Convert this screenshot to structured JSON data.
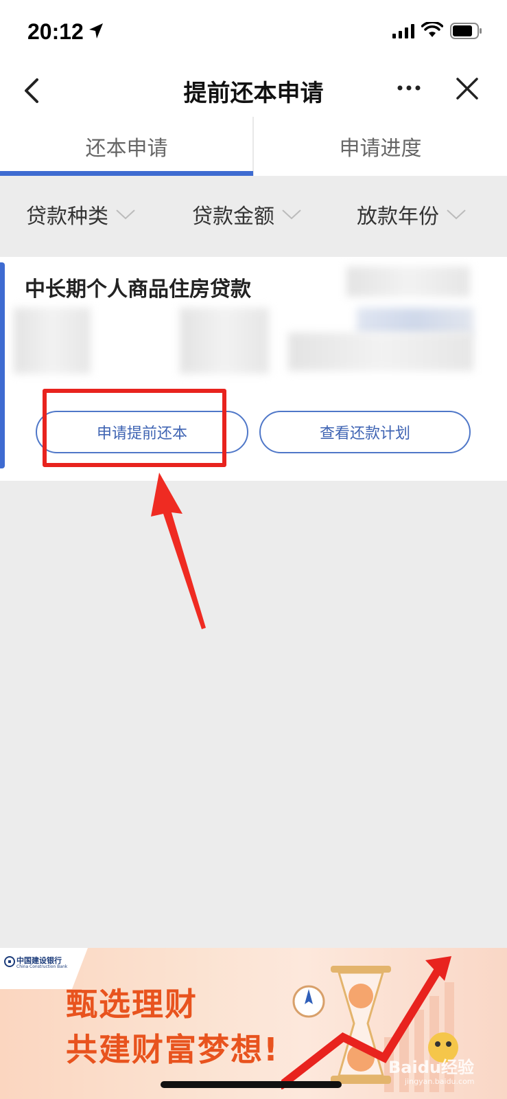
{
  "status_bar": {
    "time": "20:12",
    "icons": [
      "location-arrow-icon",
      "cellular-signal-icon",
      "wifi-icon",
      "battery-icon"
    ]
  },
  "nav": {
    "title": "提前还本申请",
    "back_icon": "chevron-left-icon",
    "more_icon": "more-dots-icon",
    "close_icon": "close-icon"
  },
  "tabs": [
    {
      "label": "还本申请",
      "active": true
    },
    {
      "label": "申请进度",
      "active": false
    }
  ],
  "filters": [
    {
      "label": "贷款种类"
    },
    {
      "label": "贷款金额"
    },
    {
      "label": "放款年份"
    }
  ],
  "loan_card": {
    "title": "中长期个人商品住房贷款",
    "buttons": {
      "apply": "申请提前还本",
      "plan": "查看还款计划"
    }
  },
  "banner": {
    "bank_name": "中国建设银行",
    "bank_name_en": "China Construction Bank",
    "line1": "甄选理财",
    "line2": "共建财富梦想!",
    "watermark": "Baidu经验",
    "watermark_sub": "jingyan.baidu.com"
  },
  "colors": {
    "accent": "#3e6bd1",
    "highlight": "#e8231e",
    "banner_text": "#e8531e"
  }
}
